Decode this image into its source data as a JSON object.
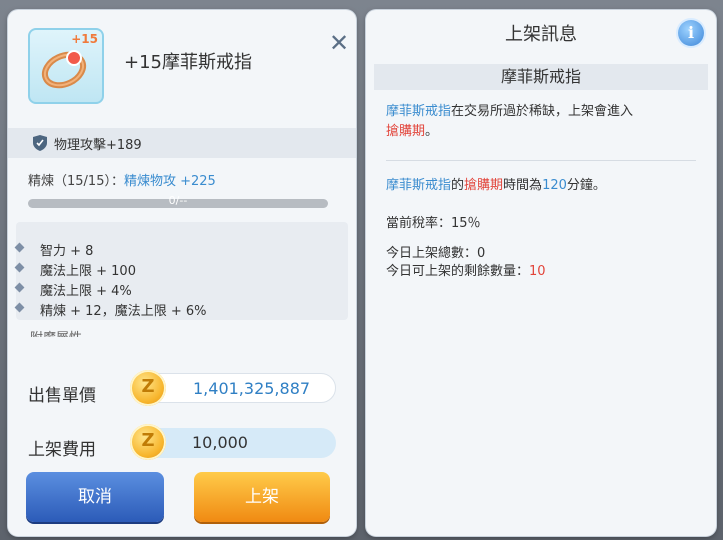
{
  "item": {
    "badge": "+15",
    "title": "+15摩菲斯戒指",
    "close_icon": "✕",
    "stat_main": "物理攻擊+189",
    "refine_label": "精煉（15/15）：",
    "refine_value": "精煉物攻 +225",
    "bar_text": "0/--",
    "attributes": [
      "智力 + 8",
      "魔法上限 + 100",
      "魔法上限 + 4%",
      "精煉 + 12，魔法上限 + 6%"
    ],
    "cut_label": "附魔屬性"
  },
  "price": {
    "sell_label": "出售單價",
    "sell_value": "1,401,325,887",
    "fee_label": "上架費用",
    "fee_value": "10,000",
    "coin_symbol": "Z"
  },
  "buttons": {
    "cancel": "取消",
    "list": "上架"
  },
  "info": {
    "title": "上架訊息",
    "info_icon": "i",
    "subtitle": "摩菲斯戒指",
    "p1_name": "摩菲斯戒指",
    "p1_text": "在交易所過於稀缺，上架會進入",
    "p1_red": "搶購期",
    "p1_end": "。",
    "p2_name": "摩菲斯戒指",
    "p2_mid": "的",
    "p2_red": "搶購期",
    "p2_text": "時間為",
    "p2_num": "120",
    "p2_end": "分鐘。",
    "tax_label": "當前稅率：",
    "tax_value": "15％",
    "count_label": "今日上架總數：",
    "count_value": "0",
    "remain_label": "今日可上架的剩餘數量：",
    "remain_value": "10"
  },
  "colors": {
    "accent_blue": "#3a8ccf",
    "accent_red": "#e2443a",
    "cancel_btn": "#2c5bb8",
    "list_btn": "#f08a12"
  }
}
